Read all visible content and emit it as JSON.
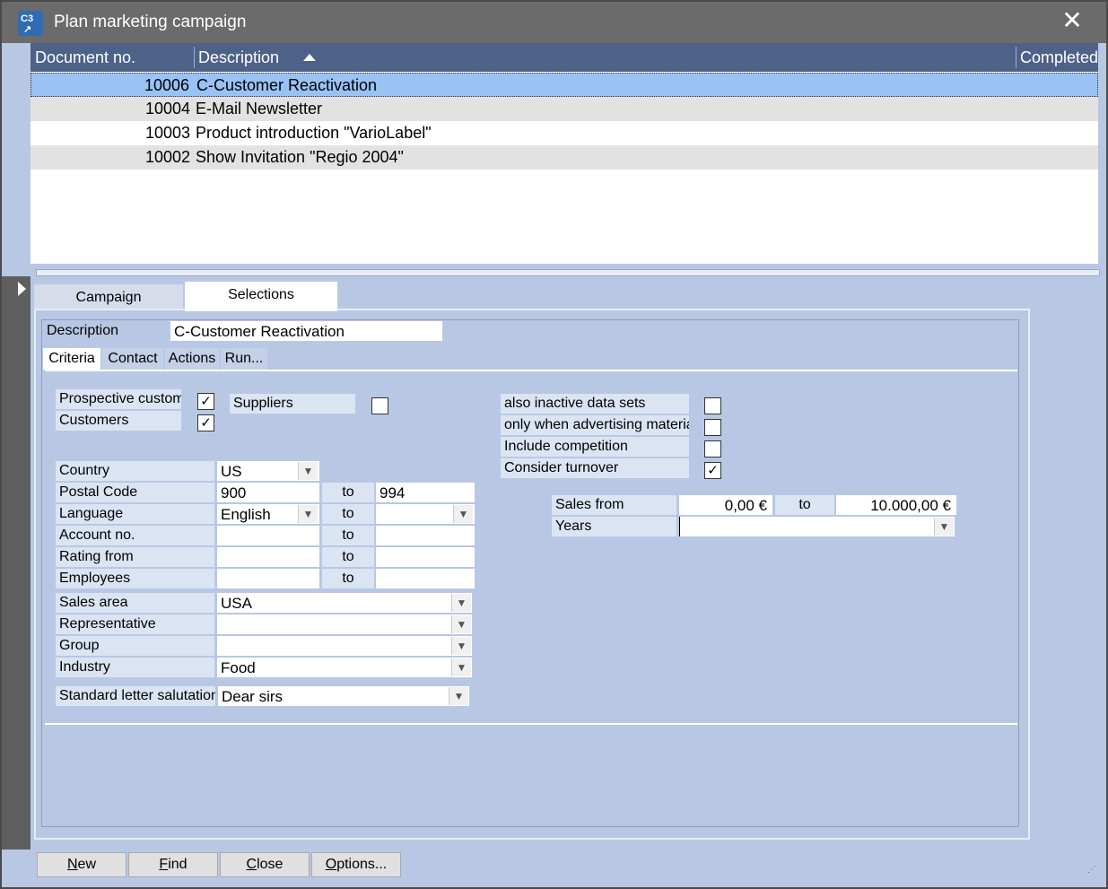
{
  "window": {
    "title": "Plan marketing campaign"
  },
  "grid": {
    "columns": {
      "doc_no": "Document no.",
      "description": "Description",
      "completed": "Completed"
    },
    "rows": [
      {
        "doc_no": "10006",
        "description": "C-Customer Reactivation",
        "selected": true
      },
      {
        "doc_no": "10004",
        "description": "E-Mail Newsletter"
      },
      {
        "doc_no": "10003",
        "description": "Product introduction \"VarioLabel\""
      },
      {
        "doc_no": "10002",
        "description": "Show Invitation \"Regio 2004\""
      }
    ]
  },
  "tabs": {
    "campaign": "Campaign",
    "selections": "Selections"
  },
  "selection": {
    "description_label": "Description",
    "description_value": "C-Customer Reactivation",
    "subtabs": {
      "criteria": "Criteria",
      "contact": "Contact",
      "actions": "Actions",
      "run": "Run..."
    },
    "criteria": {
      "prospective_label": "Prospective custom",
      "prospective_checked": true,
      "customers_label": "Customers",
      "customers_checked": true,
      "suppliers_label": "Suppliers",
      "suppliers_checked": false,
      "inactive_label": "also inactive data sets",
      "inactive_checked": false,
      "advertising_label": "only when advertising materia",
      "advertising_checked": false,
      "competition_label": "Include competition",
      "competition_checked": false,
      "turnover_label": "Consider turnover",
      "turnover_checked": true,
      "to_label": "to",
      "country_label": "Country",
      "country_value": "US",
      "postal_label": "Postal Code",
      "postal_from": "900",
      "postal_to": "994",
      "language_label": "Language",
      "language_value": "English",
      "language_to": "",
      "account_label": "Account no.",
      "rating_label": "Rating from",
      "employees_label": "Employees",
      "sales_area_label": "Sales area",
      "sales_area_value": "USA",
      "representative_label": "Representative",
      "representative_value": "",
      "group_label": "Group",
      "group_value": "",
      "industry_label": "Industry",
      "industry_value": "Food",
      "salutation_label": "Standard letter salutation",
      "salutation_value": "Dear sirs",
      "sales_from_label": "Sales from",
      "sales_from_value": "0,00 €",
      "sales_to_value": "10.000,00 €",
      "years_label": "Years",
      "years_value": ""
    }
  },
  "buttons": {
    "new": {
      "u": "N",
      "rest": "ew"
    },
    "find": {
      "u": "F",
      "rest": "ind"
    },
    "close": {
      "u": "C",
      "rest": "lose"
    },
    "options": {
      "u": "O",
      "rest": "ptions..."
    }
  }
}
